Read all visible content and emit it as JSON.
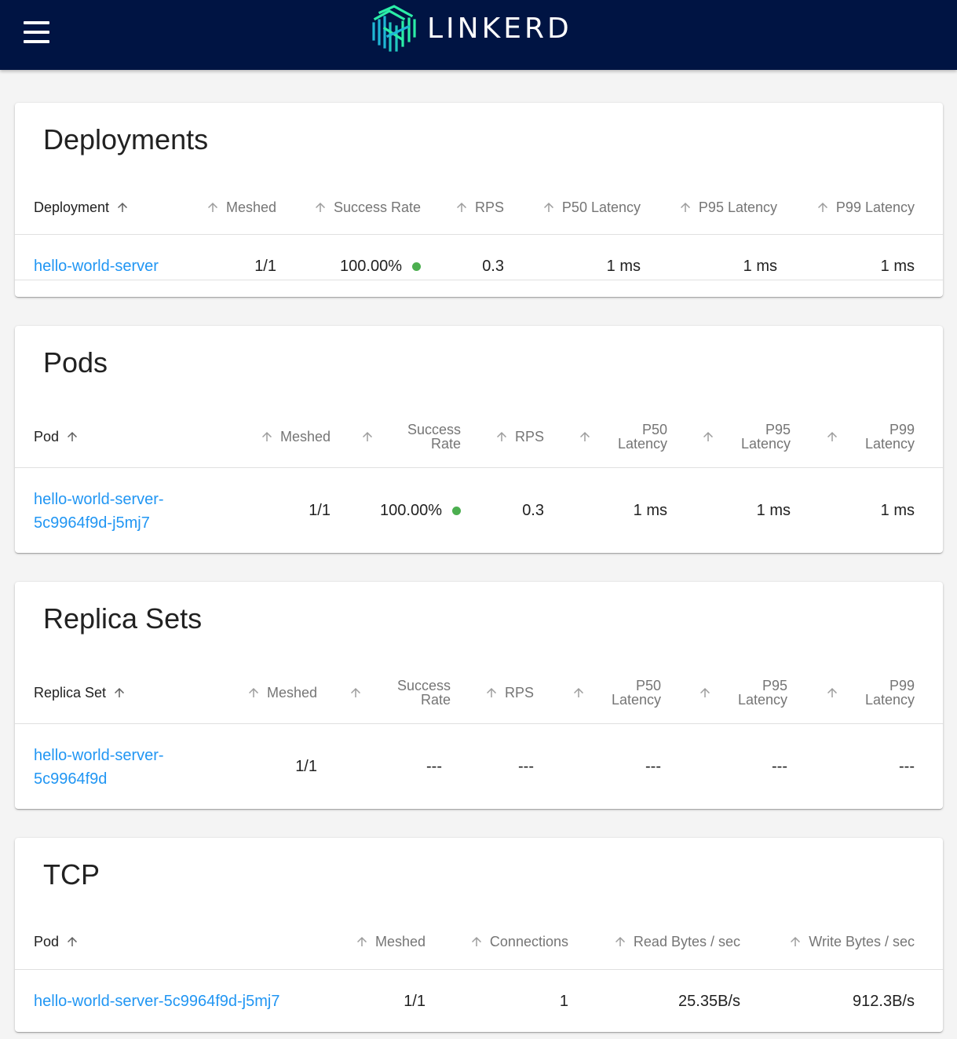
{
  "app": {
    "name": "LINKERD",
    "logo_icon": "linkerd-logo-icon",
    "menu_icon": "hamburger-menu-icon"
  },
  "colors": {
    "header_bg": "#001443",
    "link": "#2196f3",
    "status_good": "#4caf50",
    "logo_teal": "#2beda7",
    "logo_blue": "#1fb6d6"
  },
  "deployments": {
    "title": "Deployments",
    "columns": [
      "Deployment",
      "Meshed",
      "Success Rate",
      "RPS",
      "P50 Latency",
      "P95 Latency",
      "P99 Latency"
    ],
    "rows": [
      {
        "name": "hello-world-server",
        "meshed": "1/1",
        "success_rate": "100.00%",
        "rps": "0.3",
        "p50": "1 ms",
        "p95": "1 ms",
        "p99": "1 ms"
      }
    ]
  },
  "pods": {
    "title": "Pods",
    "columns": [
      "Pod",
      "Meshed",
      "Success Rate",
      "RPS",
      "P50 Latency",
      "P95 Latency",
      "P99 Latency"
    ],
    "rows": [
      {
        "name_line1": "hello-world-server-",
        "name_line2": "5c9964f9d-j5mj7",
        "meshed": "1/1",
        "success_rate": "100.00%",
        "rps": "0.3",
        "p50": "1 ms",
        "p95": "1 ms",
        "p99": "1 ms"
      }
    ]
  },
  "replica_sets": {
    "title": "Replica Sets",
    "columns": [
      "Replica Set",
      "Meshed",
      "Success Rate",
      "RPS",
      "P50 Latency",
      "P95 Latency",
      "P99 Latency"
    ],
    "rows": [
      {
        "name_line1": "hello-world-server-",
        "name_line2": "5c9964f9d",
        "meshed": "1/1",
        "success_rate": "---",
        "rps": "---",
        "p50": "---",
        "p95": "---",
        "p99": "---"
      }
    ]
  },
  "tcp": {
    "title": "TCP",
    "columns": [
      "Pod",
      "Meshed",
      "Connections",
      "Read Bytes / sec",
      "Write Bytes / sec"
    ],
    "rows": [
      {
        "name": "hello-world-server-5c9964f9d-j5mj7",
        "meshed": "1/1",
        "connections": "1",
        "read_bytes": "25.35B/s",
        "write_bytes": "912.3B/s"
      }
    ]
  }
}
